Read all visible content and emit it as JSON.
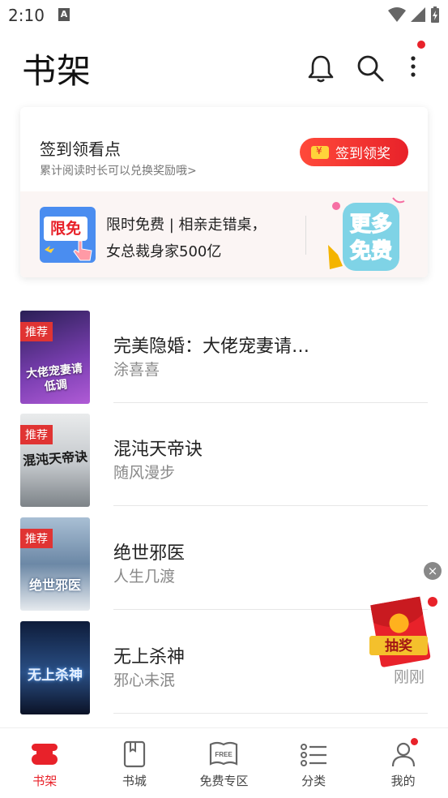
{
  "status": {
    "time": "2:10",
    "notification_letter": "A"
  },
  "header": {
    "title": "书架"
  },
  "checkin": {
    "title": "签到领看点",
    "subtitle": "累计阅读时长可以兑换奖励哦>",
    "button_label": "签到领奖"
  },
  "promo": {
    "badge": "限免",
    "line1": "限时免费 | 相亲走错桌，",
    "line2": "女总裁身家500亿",
    "more_free_top": "更多",
    "more_free_bottom": "免费"
  },
  "books": [
    {
      "title": "完美隐婚：大佬宠妻请…",
      "author": "涂喜喜",
      "tag": "推荐",
      "cover_text": "大佬宠妻请低调",
      "cover_color": "#6a3fa0"
    },
    {
      "title": "混沌天帝诀",
      "author": "随风漫步",
      "tag": "推荐",
      "cover_text": "混沌天帝诀",
      "cover_color": "#cfd3d6"
    },
    {
      "title": "绝世邪医",
      "author": "人生几渡",
      "tag": "推荐",
      "cover_text": "绝世邪医",
      "cover_color": "#7f98b4"
    },
    {
      "title": "无上杀神",
      "author": "邪心未泯",
      "tag": "",
      "cover_text": "无上杀神",
      "cover_color": "#1f3a66"
    }
  ],
  "floating": {
    "close": "×",
    "lottery_label": "抽奖",
    "time_label": "刚刚"
  },
  "nav": [
    {
      "label": "书架",
      "icon": "bookshelf-icon",
      "active": true
    },
    {
      "label": "书城",
      "icon": "book-icon",
      "active": false
    },
    {
      "label": "免费专区",
      "icon": "free-book-icon",
      "active": false,
      "icon_text": "FREE"
    },
    {
      "label": "分类",
      "icon": "list-icon",
      "active": false
    },
    {
      "label": "我的",
      "icon": "profile-icon",
      "active": false
    }
  ],
  "colors": {
    "accent": "#e8222a",
    "promo_bg": "#fbf5f4",
    "badge_blue": "#4a8df0"
  }
}
